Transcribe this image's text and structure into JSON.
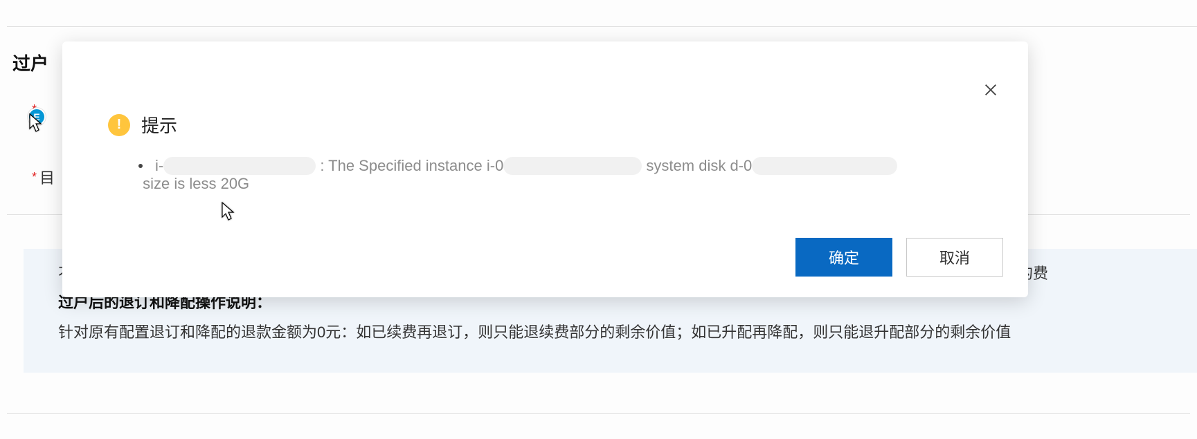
{
  "page": {
    "heading": "过户",
    "field1_label": "",
    "field2_label": "目",
    "info_line_top": "不允许进行：升降配、节省计划、续费、续约、变更操作系统、带宽升降级、退订、迁移、允许进行：自动续费／购买已加购资源关切加购账户的费",
    "info_bold": "过户后的退订和降配操作说明：",
    "info_detail": "针对原有配置退订和降配的退款金额为0元：如已续费再退订，则只能退续费部分的剩余价值；如已升配再降配，则只能退升配部分的剩余价值"
  },
  "modal": {
    "title": "提示",
    "message": {
      "p1": "i-",
      "p2": " : The Specified instance i-0",
      "p3": " system disk d-0",
      "p4": " size is less 20G"
    },
    "confirm": "确定",
    "cancel": "取消"
  },
  "colors": {
    "primary": "#0969c2",
    "warn": "#ffc53d"
  }
}
